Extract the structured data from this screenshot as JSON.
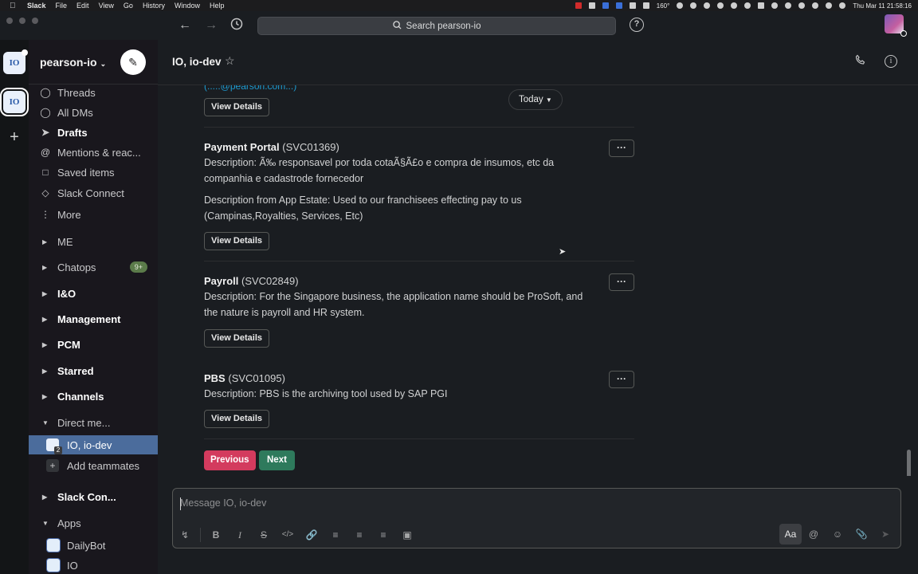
{
  "menubar": {
    "apple": "",
    "items": [
      "Slack",
      "File",
      "Edit",
      "View",
      "Go",
      "History",
      "Window",
      "Help"
    ],
    "battery": "160°",
    "clock": "Thu Mar 11  21:58:16"
  },
  "topbar": {
    "search_placeholder": "Search pearson-io"
  },
  "workspace": {
    "name": "pearson-io",
    "icon_text": "IO"
  },
  "sidebar": {
    "items": [
      {
        "label": "Threads",
        "icon": "threads-icon"
      },
      {
        "label": "All DMs",
        "icon": "dms-icon"
      },
      {
        "label": "Drafts",
        "icon": "drafts-icon"
      },
      {
        "label": "Mentions & reac...",
        "icon": "mentions-icon"
      },
      {
        "label": "Saved items",
        "icon": "bookmark-icon"
      },
      {
        "label": "Slack Connect",
        "icon": "slack-connect-icon"
      },
      {
        "label": "More",
        "icon": "more-vertical-icon"
      }
    ],
    "sections": [
      {
        "label": "ME"
      },
      {
        "label": "Chatops",
        "badge": "9+"
      },
      {
        "label": "I&O"
      },
      {
        "label": "Management"
      },
      {
        "label": "PCM"
      },
      {
        "label": "Starred"
      },
      {
        "label": "Channels"
      },
      {
        "label": "Direct me..."
      }
    ],
    "dm_active": {
      "label": "IO, io-dev",
      "count": "2"
    },
    "add_teammates": "Add teammates",
    "slack_connect_section": "Slack Con...",
    "apps_section": "Apps",
    "apps": [
      {
        "label": "DailyBot"
      },
      {
        "label": "IO"
      }
    ]
  },
  "channel": {
    "title": "IO, io-dev"
  },
  "messages": {
    "partial_link": "(.....@pearson.com...)",
    "today_label": "Today",
    "view_details": "View Details",
    "services": [
      {
        "name": "Payment Portal",
        "id": "(SVC01369)",
        "desc1": "Description: Ã‰ responsavel por toda cotaÃ§Ã£o e compra de insumos, etc da companhia e cadastrode fornecedor",
        "desc2": "Description from App Estate: Used to our franchisees effecting pay to us (Campinas,Royalties, Services, Etc)"
      },
      {
        "name": "Payroll",
        "id": "(SVC02849)",
        "desc1": "Description: For the Singapore business, the application name should be ProSoft, and the nature is payroll and HR system."
      },
      {
        "name": "PBS",
        "id": "(SVC01095)",
        "desc1": "Description: PBS is the archiving tool used by SAP PGI"
      }
    ],
    "more_label": "···",
    "previous": "Previous",
    "next": "Next"
  },
  "composer": {
    "placeholder": "Message IO, io-dev",
    "aa": "Aa"
  }
}
